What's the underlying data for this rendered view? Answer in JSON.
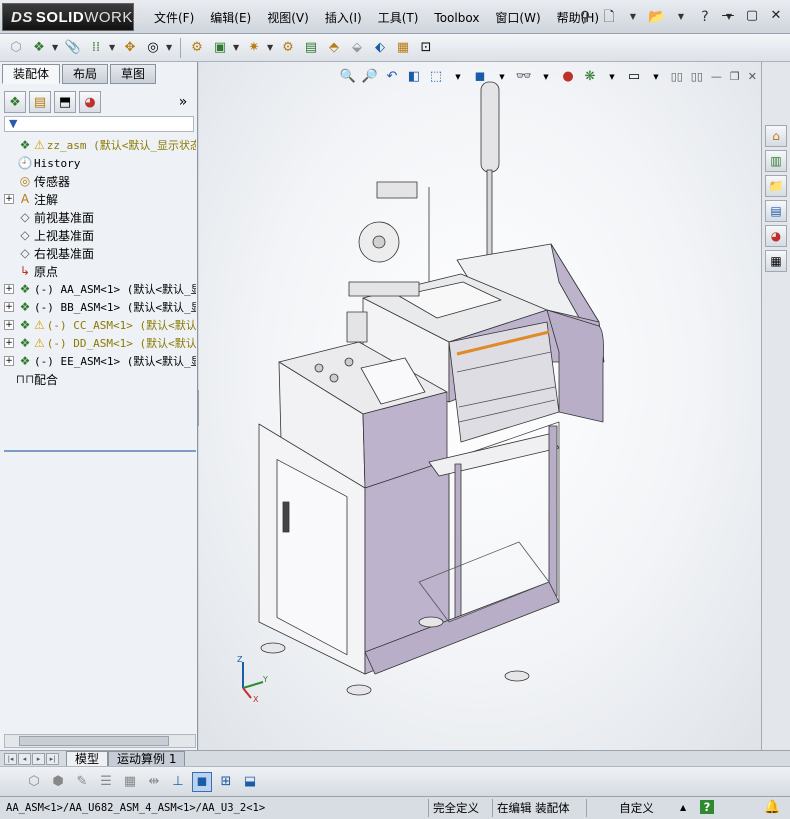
{
  "app": {
    "logo_prefix": "DS",
    "logo_solid": "SOLID",
    "logo_works": "WORKS"
  },
  "menu": [
    {
      "label": "文件(F)",
      "name": "menu-file"
    },
    {
      "label": "编辑(E)",
      "name": "menu-edit"
    },
    {
      "label": "视图(V)",
      "name": "menu-view"
    },
    {
      "label": "插入(I)",
      "name": "menu-insert"
    },
    {
      "label": "工具(T)",
      "name": "menu-tools"
    },
    {
      "label": "Toolbox",
      "name": "menu-toolbox"
    },
    {
      "label": "窗口(W)",
      "name": "menu-window"
    },
    {
      "label": "帮助(H)",
      "name": "menu-help"
    }
  ],
  "left_panel": {
    "tabs": [
      "装配体",
      "布局",
      "草图"
    ],
    "more_glyph": "»",
    "filter_glyph": "▼"
  },
  "tree": [
    {
      "label": "zz_asm  (默认<默认_显示状态",
      "icon": "assembly-icon",
      "warn": true,
      "expandable": false,
      "style": "yellow",
      "mono": true
    },
    {
      "label": "History",
      "icon": "history-icon",
      "warn": false,
      "expandable": false,
      "style": "",
      "mono": true
    },
    {
      "label": "传感器",
      "icon": "sensor-icon",
      "warn": false,
      "expandable": false,
      "style": "",
      "mono": false
    },
    {
      "label": "注解",
      "icon": "annotation-icon",
      "warn": false,
      "expandable": true,
      "style": "",
      "mono": false
    },
    {
      "label": "前视基准面",
      "icon": "plane-icon",
      "warn": false,
      "expandable": false,
      "style": "",
      "mono": false
    },
    {
      "label": "上视基准面",
      "icon": "plane-icon",
      "warn": false,
      "expandable": false,
      "style": "",
      "mono": false
    },
    {
      "label": "右视基准面",
      "icon": "plane-icon",
      "warn": false,
      "expandable": false,
      "style": "",
      "mono": false
    },
    {
      "label": "原点",
      "icon": "origin-icon",
      "warn": false,
      "expandable": false,
      "style": "",
      "mono": false
    },
    {
      "label": "(-) AA_ASM<1> (默认<默认_显",
      "icon": "subassembly-icon",
      "warn": false,
      "expandable": true,
      "style": "",
      "mono": true
    },
    {
      "label": "(-) BB_ASM<1> (默认<默认_显",
      "icon": "subassembly-icon",
      "warn": false,
      "expandable": true,
      "style": "",
      "mono": true
    },
    {
      "label": "(-) CC_ASM<1> (默认<默认",
      "icon": "subassembly-icon",
      "warn": true,
      "expandable": true,
      "style": "yellow",
      "mono": true
    },
    {
      "label": "(-) DD_ASM<1> (默认<默认",
      "icon": "subassembly-icon",
      "warn": true,
      "expandable": true,
      "style": "yellow",
      "mono": true
    },
    {
      "label": "(-) EE_ASM<1> (默认<默认_显",
      "icon": "subassembly-icon",
      "warn": false,
      "expandable": true,
      "style": "",
      "mono": true
    },
    {
      "label": "配合",
      "icon": "mates-icon",
      "warn": false,
      "expandable": false,
      "style": "",
      "mono": false
    }
  ],
  "triad": {
    "z": "Z",
    "y": "Y",
    "x": "X"
  },
  "model_tabs": [
    "模型",
    "运动算例 1"
  ],
  "status": {
    "path": "AA_ASM<1>/AA_U682_ASM_4_ASM<1>/AA_U3_2<1>",
    "definition": "完全定义",
    "mode": "在编辑 装配体",
    "units": "自定义",
    "help": "?"
  },
  "colors": {
    "machine_body": "#b7adc6",
    "machine_panel": "#f2f2f4",
    "accent_orange": "#e08a2a",
    "viewport_bg": "#f2f4f7"
  }
}
